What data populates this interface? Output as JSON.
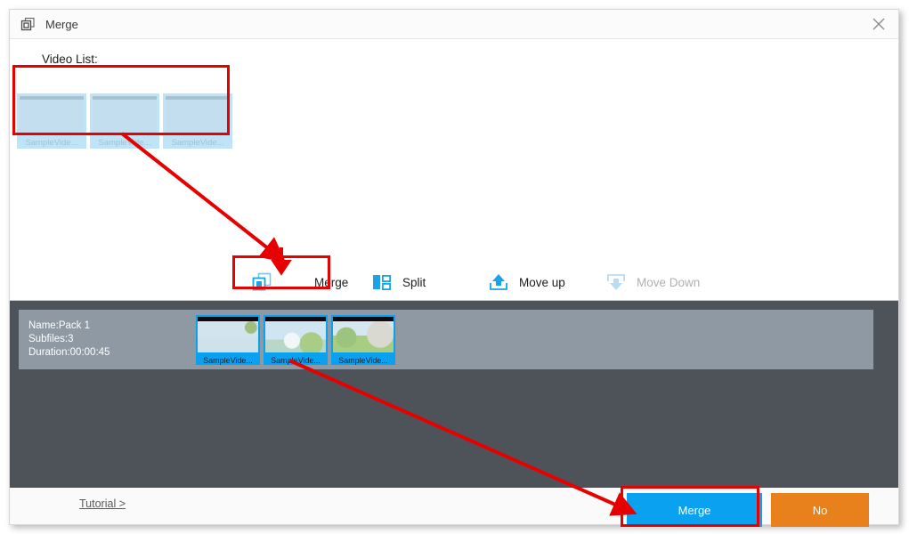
{
  "window": {
    "title": "Merge",
    "title_icon": "merge-window-icon",
    "close_icon": "close-icon"
  },
  "upper": {
    "list_label": "Video List:",
    "videos": [
      {
        "caption": "SampleVide...",
        "frame": "frameA"
      },
      {
        "caption": "SampleVide...",
        "frame": "frameB"
      },
      {
        "caption": "SampleVide...",
        "frame": "frameC"
      }
    ]
  },
  "toolbar": {
    "merge": {
      "label": "Merge",
      "icon": "merge-icon",
      "enabled": true
    },
    "split": {
      "label": "Split",
      "icon": "split-icon",
      "enabled": true
    },
    "move_up": {
      "label": "Move up",
      "icon": "move-up-icon",
      "enabled": true
    },
    "move_down": {
      "label": "Move Down",
      "icon": "move-down-icon",
      "enabled": false
    }
  },
  "pack": {
    "name_line": "Name:Pack 1",
    "subfiles_line": "Subfiles:3",
    "duration_line": "Duration:00:00:45",
    "thumbs": [
      {
        "caption": "SampleVide...",
        "frame": "frameA"
      },
      {
        "caption": "SampleVide...",
        "frame": "frameB"
      },
      {
        "caption": "SampleVide...",
        "frame": "frameC"
      }
    ]
  },
  "footer": {
    "tutorial": "Tutorial >",
    "merge_button": "Merge",
    "no_button": "No"
  },
  "colors": {
    "accent_blue": "#0aa2f0",
    "orange": "#e8801b",
    "dark_panel": "#4e535a",
    "pack_row": "#8e99a3",
    "annotation_red": "#e60000",
    "thumb_selected": "#0aa2f0",
    "thumb_unselected": "#bfe4f8"
  },
  "annotations": {
    "box_video_list": "highlight-video-list",
    "box_toolbar_merge": "highlight-toolbar-merge",
    "box_footer_merge": "highlight-footer-merge",
    "arrow_1": "arrow-video-list-to-merge-tool",
    "arrow_2": "arrow-pack-to-merge-button"
  }
}
